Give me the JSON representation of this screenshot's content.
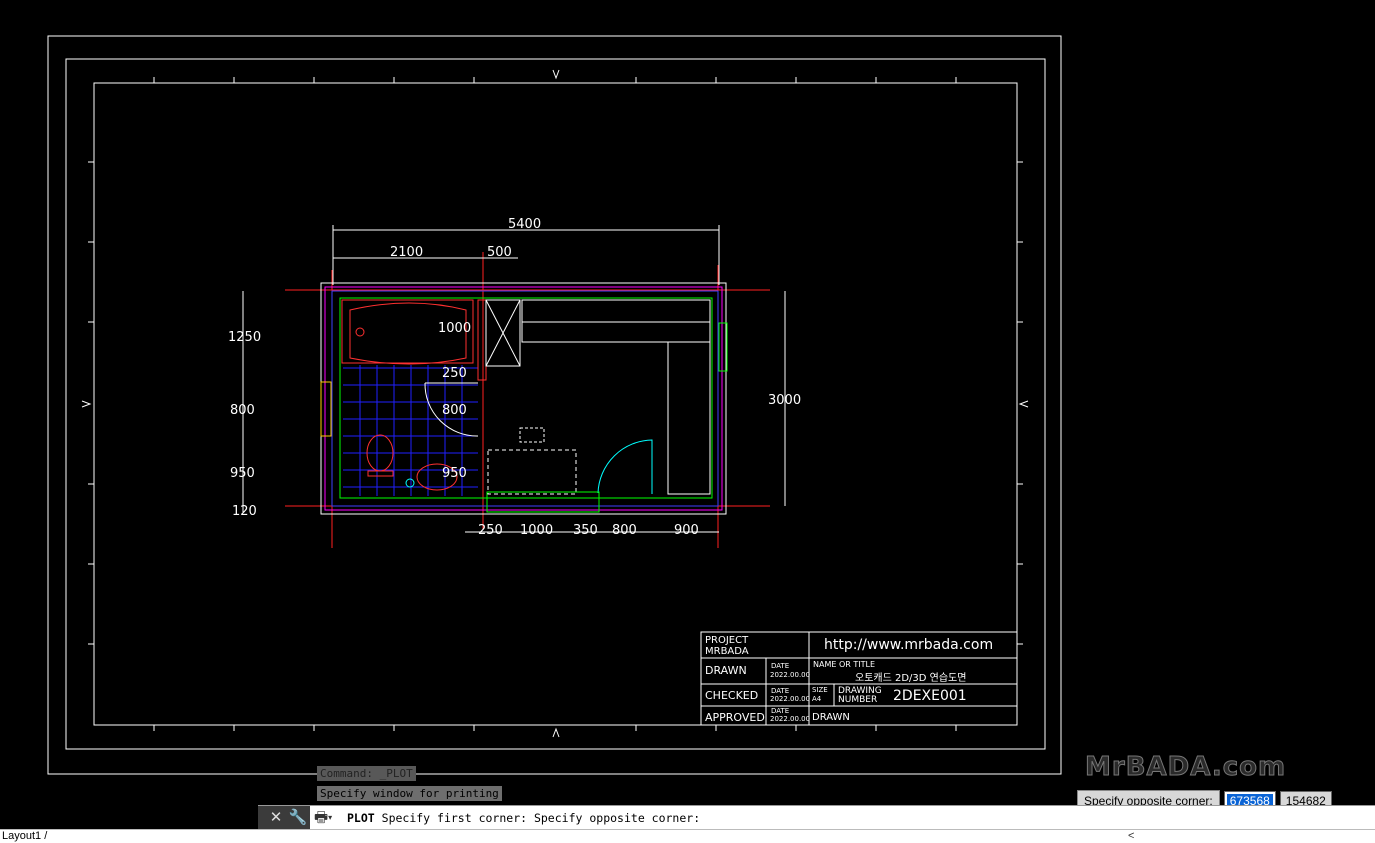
{
  "drawing": {
    "dims": {
      "overall_width": "5400",
      "top_left": "2100",
      "top_mid": "500",
      "left_1": "1250",
      "left_2": "800",
      "left_3": "950",
      "left_4": "120",
      "inner_1": "1000",
      "inner_2": "250",
      "inner_3": "800",
      "inner_4": "950",
      "right": "3000",
      "bottom_1": "250",
      "bottom_2": "1000",
      "bottom_3": "350",
      "bottom_4": "800",
      "bottom_5": "900"
    },
    "title_block": {
      "project_label": "PROJECT",
      "project_value": "MRBADA",
      "url": "http://www.mrbada.com",
      "drawn": "DRAWN",
      "checked": "CHECKED",
      "approved": "APPROVED",
      "date_label": "DATE",
      "date_value": "2022.00.00",
      "name_label": "NAME OR TITLE",
      "name_value": "오토캐드 2D/3D 연습도면",
      "size_label": "SIZE",
      "size_value": "A4",
      "drawing_label_1": "DRAWING",
      "drawing_label_2": "NUMBER",
      "drawing_number": "2DEXE001",
      "drawn_by": "DRAWN"
    }
  },
  "command": {
    "history_1": "Command: _PLOT",
    "history_2": "Specify window for printing",
    "cmd_name": "PLOT",
    "line": "Specify first corner: Specify opposite corner:"
  },
  "tooltip": {
    "label": "Specify opposite corner:",
    "x": "673568",
    "y": "154682"
  },
  "watermark": "MrBADA.com",
  "status": {
    "layout_tab": "Layout1 /",
    "scroll_left": "<"
  },
  "icons": [
    "close-icon",
    "wrench-icon",
    "printer-icon",
    "chevron-down-icon"
  ]
}
